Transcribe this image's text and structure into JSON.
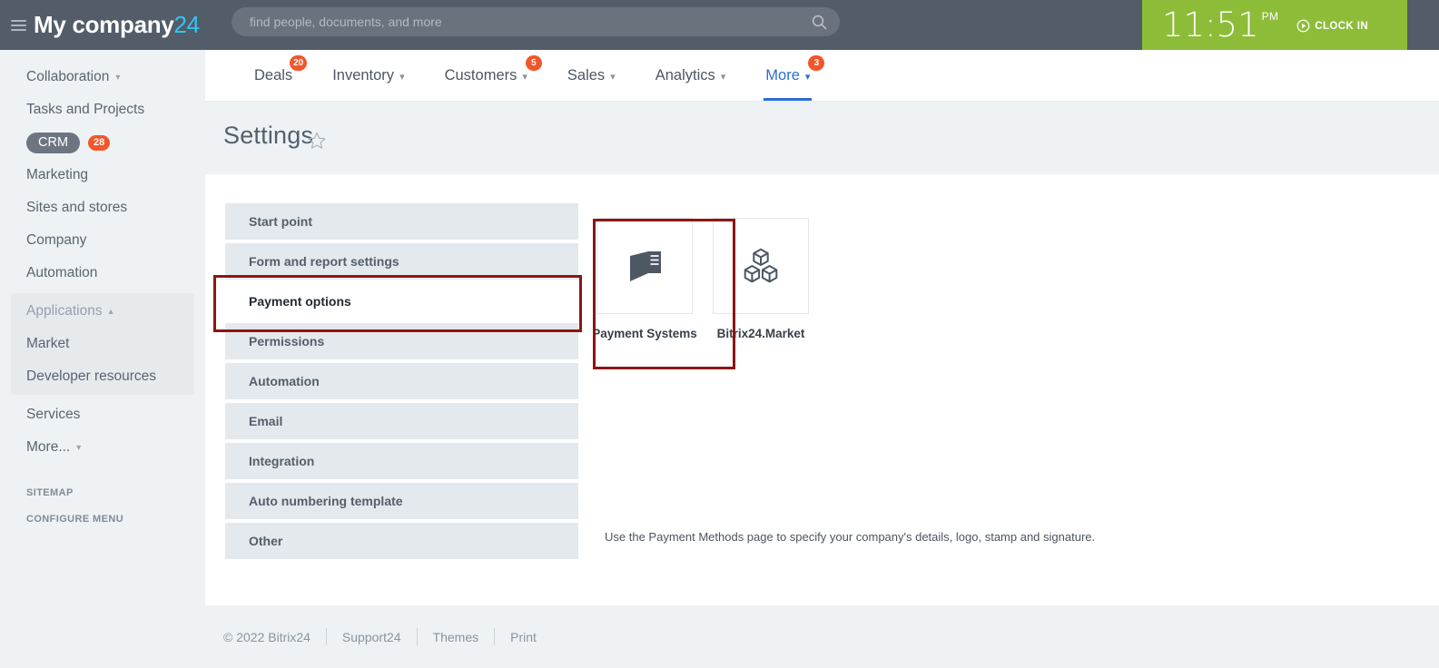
{
  "topbar": {
    "menu_icon": "hamburger-icon",
    "brand_name": "My company",
    "brand_number": "24",
    "search": {
      "placeholder": "find people, documents, and more",
      "value": "",
      "icon": "search-icon"
    },
    "clock": {
      "time": "11:51",
      "ampm": "PM",
      "action_label": "CLOCK IN",
      "action_icon": "play-circle-icon",
      "background": "#8dbd38"
    }
  },
  "sidebar": {
    "items": [
      {
        "label": "Collaboration",
        "chevron": "chevron-down-icon",
        "name": "collaboration"
      },
      {
        "label": "Tasks and Projects",
        "name": "tasks-and-projects"
      },
      {
        "label": "CRM",
        "badge": "28",
        "pill": true,
        "name": "crm"
      },
      {
        "label": "Marketing",
        "name": "marketing"
      },
      {
        "label": "Sites and stores",
        "name": "sites-and-stores"
      },
      {
        "label": "Company",
        "name": "company"
      },
      {
        "label": "Automation",
        "name": "automation"
      }
    ],
    "applications_group": {
      "label": "Applications",
      "chevron": "chevron-up-icon",
      "items": [
        {
          "label": "Market",
          "name": "market"
        },
        {
          "label": "Developer resources",
          "name": "developer-resources"
        }
      ]
    },
    "after_items": [
      {
        "label": "Services",
        "name": "services"
      },
      {
        "label": "More...",
        "chevron": "caret-down-icon",
        "name": "more"
      }
    ],
    "captions": [
      {
        "label": "SITEMAP",
        "name": "sitemap"
      },
      {
        "label": "CONFIGURE MENU",
        "name": "configure-menu"
      }
    ]
  },
  "nav": {
    "tabs": [
      {
        "label": "Deals",
        "badge": "20",
        "chevron": false,
        "active": false
      },
      {
        "label": "Inventory",
        "chevron": true,
        "active": false
      },
      {
        "label": "Customers",
        "badge": "5",
        "chevron": true,
        "active": false
      },
      {
        "label": "Sales",
        "chevron": true,
        "active": false
      },
      {
        "label": "Analytics",
        "chevron": true,
        "active": false
      },
      {
        "label": "More",
        "badge": "3",
        "chevron": true,
        "active": true
      }
    ],
    "active_color": "#2a6fd1"
  },
  "page": {
    "title": "Settings",
    "favorite_icon": "star-outline-icon"
  },
  "settings_tabs": [
    {
      "label": "Start point",
      "active": false
    },
    {
      "label": "Form and report settings",
      "active": false
    },
    {
      "label": "Payment options",
      "active": true
    },
    {
      "label": "Permissions",
      "active": false
    },
    {
      "label": "Automation",
      "active": false
    },
    {
      "label": "Email",
      "active": false
    },
    {
      "label": "Integration",
      "active": false
    },
    {
      "label": "Auto numbering template",
      "active": false
    },
    {
      "label": "Other",
      "active": false
    }
  ],
  "cards": [
    {
      "label": "Payment Systems",
      "icon": "wallet-icon",
      "highlighted": true
    },
    {
      "label": "Bitrix24.Market",
      "icon": "cubes-icon",
      "highlighted": false
    }
  ],
  "hint": "Use the Payment Methods page to specify your company's details, logo, stamp and signature.",
  "footer": {
    "copyright": "© 2022 Bitrix24",
    "links": [
      "Support24",
      "Themes",
      "Print"
    ]
  },
  "annotations": {
    "color": "#8c1515",
    "boxes": [
      "payment-options-tab",
      "payment-systems-card"
    ]
  }
}
